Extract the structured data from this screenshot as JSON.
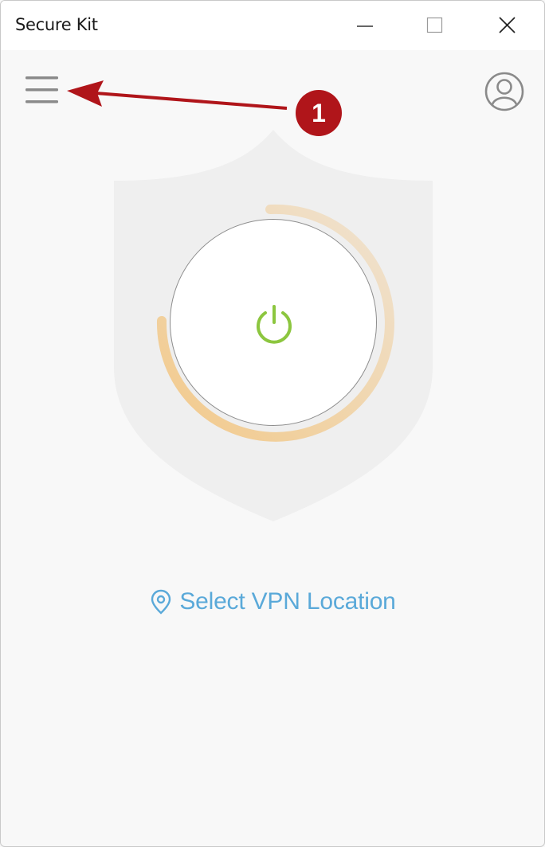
{
  "window": {
    "title": "Secure Kit"
  },
  "main": {
    "location_label": "Select VPN Location"
  },
  "annotation": {
    "badge_number": "1"
  },
  "colors": {
    "accent_blue": "#5aa9d9",
    "power_green": "#8cc63f",
    "ring_orange": "#f2c98a",
    "annotation_red": "#b0151a"
  },
  "icons": {
    "menu": "hamburger-menu-icon",
    "profile": "user-profile-icon",
    "power": "power-icon",
    "location": "map-pin-icon"
  }
}
